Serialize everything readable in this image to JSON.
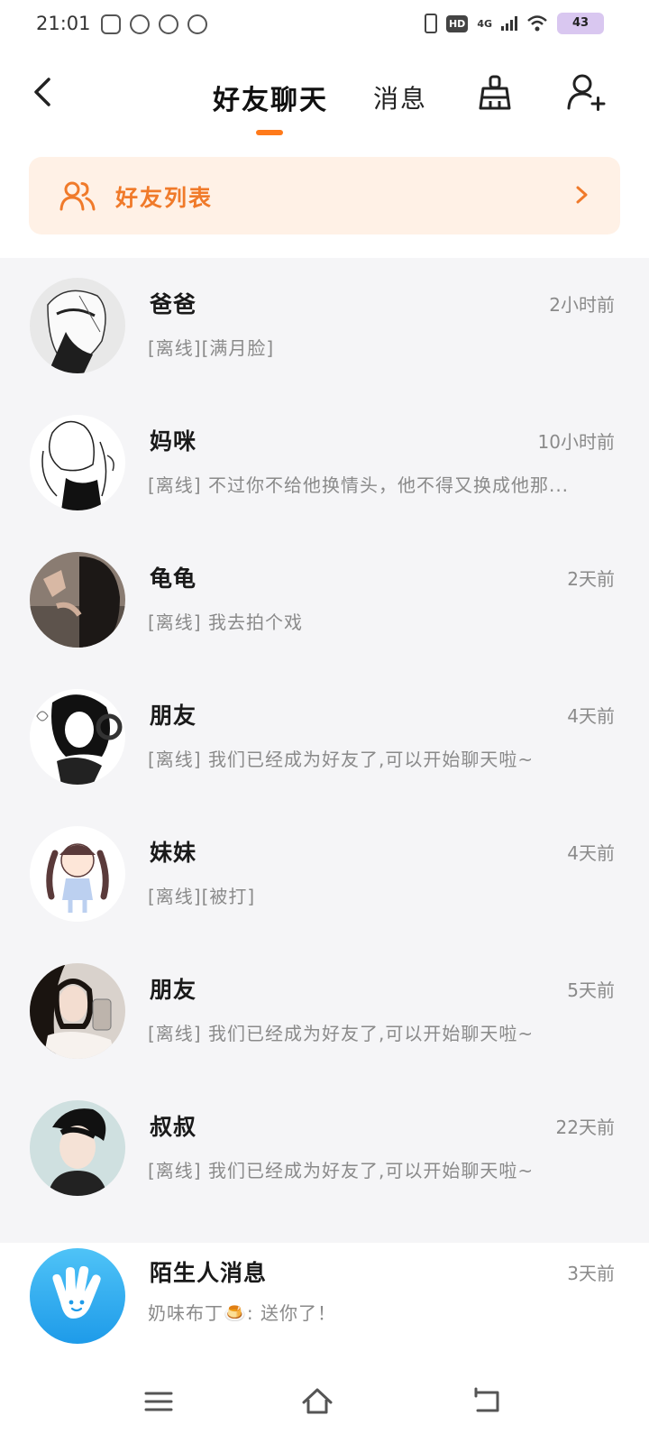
{
  "status_bar": {
    "time": "21:01",
    "network": "4G",
    "hd": "HD",
    "battery": "43"
  },
  "header": {
    "tab_friends_chat": "好友聊天",
    "tab_messages": "消息"
  },
  "banner": {
    "label": "好友列表",
    "accent_color": "#f07a2a"
  },
  "conversations": [
    {
      "name": "爸爸",
      "time": "2小时前",
      "preview": "[离线][满月脸]"
    },
    {
      "name": "妈咪",
      "time": "10小时前",
      "preview": "[离线] 不过你不给他换情头，他不得又换成他那..."
    },
    {
      "name": "龟龟",
      "time": "2天前",
      "preview": "[离线] 我去拍个戏"
    },
    {
      "name": "朋友",
      "time": "4天前",
      "preview": "[离线] 我们已经成为好友了,可以开始聊天啦~"
    },
    {
      "name": "妹妹",
      "time": "4天前",
      "preview": "[离线][被打]"
    },
    {
      "name": "朋友",
      "time": "5天前",
      "preview": "[离线] 我们已经成为好友了,可以开始聊天啦~"
    },
    {
      "name": "叔叔",
      "time": "22天前",
      "preview": "[离线] 我们已经成为好友了,可以开始聊天啦~"
    }
  ],
  "stranger": {
    "name": "陌生人消息",
    "time": "3天前",
    "preview": "奶味布丁🍮: 送你了！"
  },
  "icons": {
    "back": "back-arrow-icon",
    "clean": "broom-icon",
    "add_friend": "add-user-icon",
    "friends": "users-icon",
    "chevron": "chevron-right-icon",
    "nav_menu": "menu-icon",
    "nav_home": "home-icon",
    "nav_back": "nav-back-icon"
  }
}
